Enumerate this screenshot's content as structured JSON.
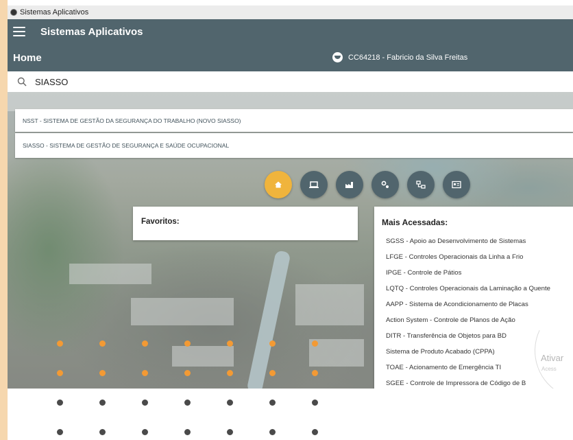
{
  "window": {
    "title": "Sistemas Aplicativos"
  },
  "appbar": {
    "title": "Sistemas Aplicativos"
  },
  "subbar": {
    "page": "Home",
    "user": "CC64218 - Fabricio da Silva Freitas"
  },
  "search": {
    "value": "SIASSO",
    "placeholder": ""
  },
  "dropdown": [
    "NSST - SISTEMA DE GESTÃO DA SEGURANÇA DO TRABALHO (NOVO SIASSO)",
    "SIASSO - SISTEMA DE GESTÃO DE SEGURANÇA E SAÚDE OCUPACIONAL"
  ],
  "nav_icons": [
    "home-icon",
    "laptop-icon",
    "factory-icon",
    "gears-icon",
    "hierarchy-icon",
    "id-card-icon"
  ],
  "favoritos": {
    "title": "Favoritos:"
  },
  "mais_acessadas": {
    "title": "Mais Acessadas:",
    "items": [
      "SGSS - Apoio ao Desenvolvimento de Sistemas",
      "LFGE - Controles Operacionais da Linha a Frio",
      "IPGE - Controle de Pátios",
      "LQTQ - Controles Operacionais da Laminação a Quente",
      "AAPP - Sistema de Acondicionamento de Placas",
      "Action System - Controle de Planos de Ação",
      "DITR - Transferência de Objetos para BD",
      "Sistema de Produto Acabado (CPPA)",
      "TOAE - Acionamento de Emergência TI",
      "SGEE - Controle de Impressora de Código de B"
    ]
  },
  "watermark": {
    "line1": "Ativar",
    "line2": "Acess"
  },
  "colors": {
    "primary": "#51656d",
    "accent": "#f0b43c",
    "orange_dots": "#f39a34",
    "gray_dots": "#4a4a4a",
    "side_strip": "#f6d7ae"
  }
}
